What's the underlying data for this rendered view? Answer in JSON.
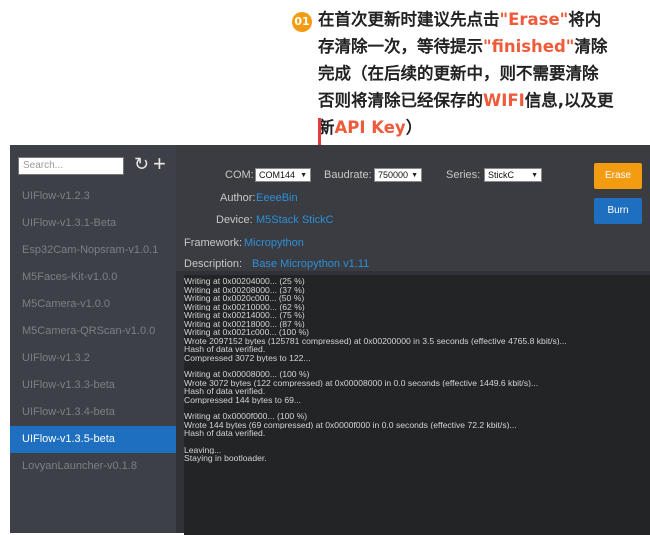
{
  "callout": {
    "number": "01",
    "lines": [
      [
        {
          "t": "在首次更新时建议先点击"
        },
        {
          "t": "\"Erase\"",
          "h": true
        },
        {
          "t": "将内"
        }
      ],
      [
        {
          "t": "存清除一次，等待提示"
        },
        {
          "t": "\"finished\"",
          "h": true
        },
        {
          "t": "清除"
        }
      ],
      [
        {
          "t": "完成（在后续的更新中，则不需要清除"
        }
      ],
      [
        {
          "t": "否则将清除已经保存的"
        },
        {
          "t": "WIFI",
          "h": true
        },
        {
          "t": "信息,以及更"
        }
      ],
      [
        {
          "t": "新"
        },
        {
          "t": "API Key",
          "h": true
        },
        {
          "t": "）"
        }
      ]
    ]
  },
  "sidebar": {
    "search_placeholder": "Search...",
    "items": [
      "UIFlow-v1.2.3",
      "UIFlow-v1.3.1-Beta",
      "Esp32Cam-Nopsram-v1.0.1",
      "M5Faces-Kit-v1.0.0",
      "M5Camera-v1.0.0",
      "M5Camera-QRScan-v1.0.0",
      "UIFlow-v1.3.2",
      "UIFlow-v1.3.3-beta",
      "UIFlow-v1.3.4-beta",
      "UIFlow-v1.3.5-beta",
      "LovyanLauncher-v0.1.8"
    ],
    "selected": "UIFlow-v1.3.5-beta"
  },
  "config": {
    "com_label": "COM:",
    "com_value": "COM144",
    "baud_label": "Baudrate:",
    "baud_value": "750000",
    "series_label": "Series:",
    "series_value": "StickC",
    "author_label": "Author:",
    "author_value": "EeeeBin",
    "device_label": "Device:",
    "device_value": "M5Stack StickC",
    "framework_label": "Framework:",
    "framework_value": "Micropython",
    "description_label": "Description:",
    "description_value": "Base Micropython v1.11"
  },
  "buttons": {
    "erase": "Erase",
    "burn": "Burn"
  },
  "console_lines": [
    "Writing at 0x00204000... (25 %)",
    "Writing at 0x00208000... (37 %)",
    "Writing at 0x0020c000... (50 %)",
    "Writing at 0x00210000... (62 %)",
    "Writing at 0x00214000... (75 %)",
    "Writing at 0x00218000... (87 %)",
    "Writing at 0x0021c000... (100 %)",
    "Wrote 2097152 bytes (125781 compressed) at 0x00200000 in 3.5 seconds (effective 4765.8 kbit/s)...",
    "Hash of data verified.",
    "Compressed 3072 bytes to 122...",
    "",
    "Writing at 0x00008000... (100 %)",
    "Wrote 3072 bytes (122 compressed) at 0x00008000 in 0.0 seconds (effective 1449.6 kbit/s)...",
    "Hash of data verified.",
    "Compressed 144 bytes to 69...",
    "",
    "Writing at 0x0000f000... (100 %)",
    "Wrote 144 bytes (69 compressed) at 0x0000f000 in 0.0 seconds (effective 72.2 kbit/s)...",
    "Hash of data verified.",
    "",
    "Leaving...",
    "Staying in bootloader."
  ],
  "colors": {
    "accent_orange": "#f39c12",
    "accent_blue": "#1e6fc0",
    "highlight_red": "#ef5a3a",
    "pointer_line": "#e33b3b"
  }
}
